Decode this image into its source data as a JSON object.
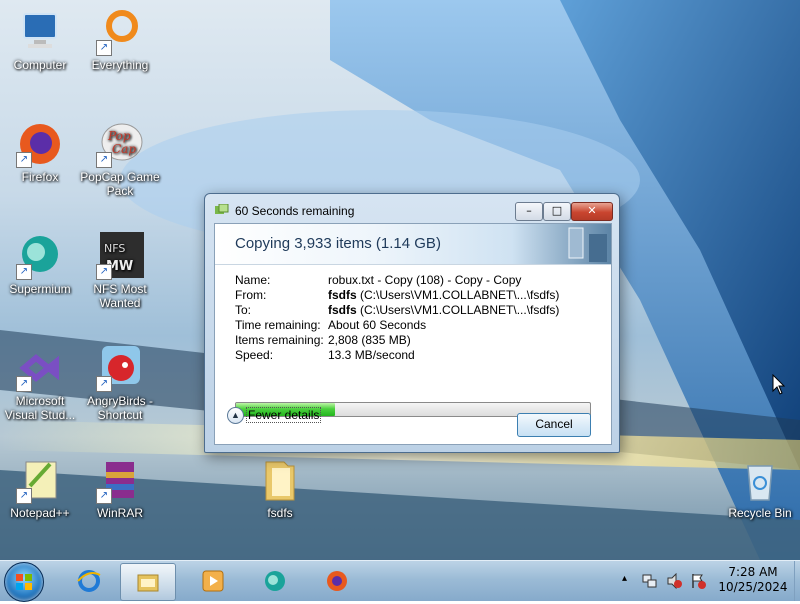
{
  "desktop": {
    "icons": [
      {
        "label": "Computer",
        "icon": "computer-icon"
      },
      {
        "label": "Everything",
        "icon": "everything-icon"
      },
      {
        "label": "Firefox",
        "icon": "firefox-icon"
      },
      {
        "label": "PopCap Game Pack",
        "icon": "popcap-icon"
      },
      {
        "label": "Supermium",
        "icon": "supermium-icon"
      },
      {
        "label": "NFS Most Wanted",
        "icon": "nfs-icon"
      },
      {
        "label": "Microsoft Visual Stud...",
        "icon": "visual-studio-icon"
      },
      {
        "label": "AngryBirds - Shortcut",
        "icon": "angry-birds-icon"
      },
      {
        "label": "Notepad++",
        "icon": "notepadpp-icon"
      },
      {
        "label": "WinRAR",
        "icon": "winrar-icon"
      },
      {
        "label": "fsdfs",
        "icon": "folder-icon"
      },
      {
        "label": "Recycle Bin",
        "icon": "recycle-bin-icon"
      }
    ]
  },
  "dialog": {
    "title": "60 Seconds remaining",
    "heading": "Copying 3,933 items (1.14 GB)",
    "details": {
      "name_key": "Name:",
      "name_val": "robux.txt - Copy (108) - Copy - Copy",
      "from_key": "From:",
      "from_bold": "fsdfs",
      "from_path": "(C:\\Users\\VM1.COLLABNET\\...\\fsdfs)",
      "to_key": "To:",
      "to_bold": "fsdfs",
      "to_path": "(C:\\Users\\VM1.COLLABNET\\...\\fsdfs)",
      "time_key": "Time remaining:",
      "time_val": "About 60 Seconds",
      "items_key": "Items remaining:",
      "items_val": "2,808 (835 MB)",
      "speed_key": "Speed:",
      "speed_val": "13.3 MB/second"
    },
    "progress_fraction": 0.28,
    "fewer_details_label": "Fewer details",
    "cancel_label": "Cancel",
    "window_buttons": {
      "minimize": "–",
      "maximize": "□",
      "close": "✕"
    }
  },
  "taskbar": {
    "items": [
      {
        "icon": "internet-explorer-icon",
        "active": false
      },
      {
        "icon": "file-explorer-icon",
        "active": true
      },
      {
        "icon": "media-player-icon",
        "active": false
      },
      {
        "icon": "supermium-icon",
        "active": false
      },
      {
        "icon": "firefox-icon",
        "active": false
      }
    ],
    "tray": {
      "chevron": "▴",
      "time": "7:28 AM",
      "date": "10/25/2024"
    }
  },
  "colors": {
    "progress_green": "#23b51e",
    "close_red": "#c9452f"
  }
}
